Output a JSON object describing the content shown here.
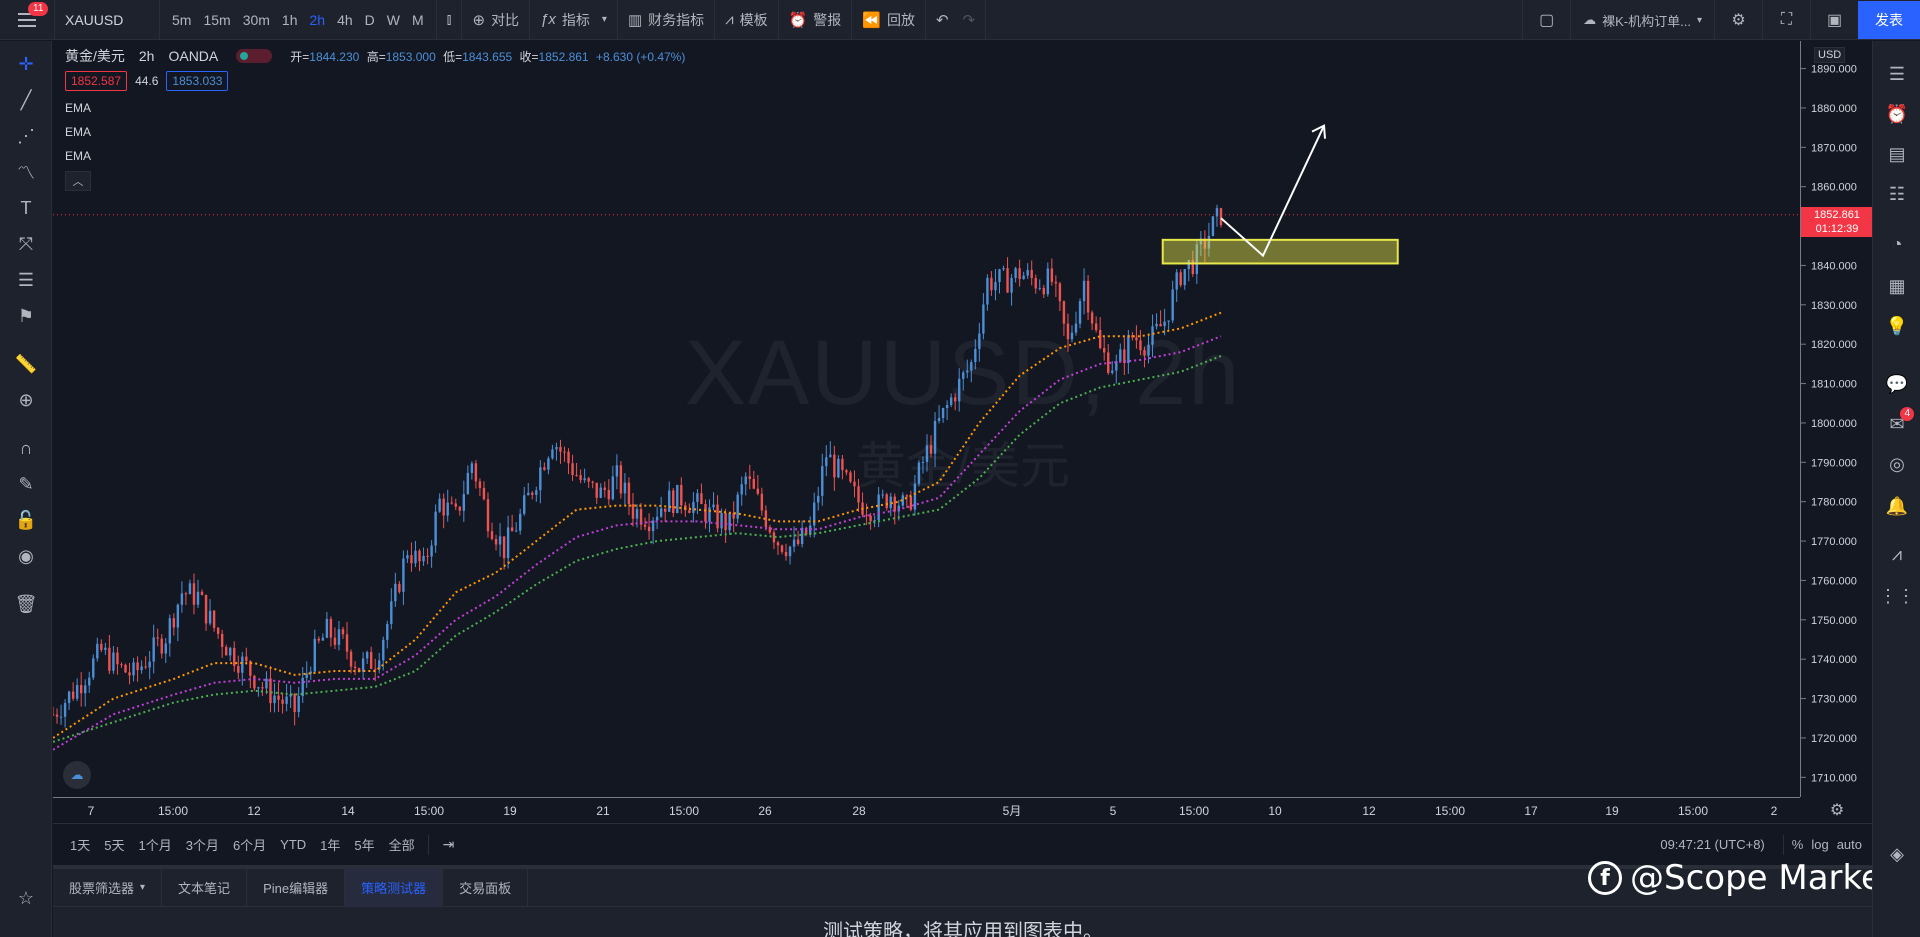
{
  "topbar": {
    "menu_badge": "11",
    "symbol": "XAUUSD",
    "intervals": [
      "5m",
      "15m",
      "30m",
      "1h",
      "2h",
      "4h",
      "D",
      "W",
      "M"
    ],
    "active_interval": "2h",
    "compare": "对比",
    "indicators": "指标",
    "financials": "财务指标",
    "templates": "模板",
    "alert": "警报",
    "replay": "回放",
    "layout_name": "裸K-机构订单...",
    "publish": "发表"
  },
  "legend": {
    "title": "黄金/美元",
    "interval": "2h",
    "exchange": "OANDA",
    "open_label": "开=",
    "open": "1844.230",
    "high_label": "高=",
    "high": "1853.000",
    "low_label": "低=",
    "low": "1843.655",
    "close_label": "收=",
    "close": "1852.861",
    "change": "+8.630 (+0.47%)",
    "bid": "1852.587",
    "spread": "44.6",
    "ask": "1853.033",
    "indicators": [
      "EMA",
      "EMA",
      "EMA"
    ]
  },
  "watermark": {
    "line1": "XAUUSD, 2h",
    "line2": "黄金/美元"
  },
  "price_axis": {
    "currency": "USD",
    "current_price": "1852.861",
    "countdown": "01:12:39"
  },
  "rangebar": {
    "ranges": [
      "1天",
      "5天",
      "1个月",
      "3个月",
      "6个月",
      "YTD",
      "1年",
      "5年",
      "全部"
    ],
    "time": "09:47:21 (UTC+8)",
    "percent": "%",
    "log": "log",
    "auto": "auto"
  },
  "bottom": {
    "tabs": [
      "股票筛选器",
      "文本笔记",
      "Pine编辑器",
      "策略测试器",
      "交易面板"
    ],
    "active_tab": "策略测试器",
    "message": "测试策略，将其应用到图表中。"
  },
  "brand": {
    "name": "@Scope Markets"
  },
  "colors": {
    "up": "#4c8fd6",
    "down": "#ef5350",
    "ema_fast": "#ff9800",
    "ema_mid": "#c040d8",
    "ema_slow": "#4caf50",
    "highlight": "#e8e84a",
    "accent": "#2962ff"
  },
  "chart_data": {
    "type": "candlestick",
    "symbol": "XAUUSD",
    "interval": "2h",
    "ylim": [
      1705,
      1897
    ],
    "y_ticks": [
      1710,
      1720,
      1730,
      1740,
      1750,
      1760,
      1770,
      1780,
      1790,
      1800,
      1810,
      1820,
      1830,
      1840,
      1850,
      1860,
      1870,
      1880,
      1890
    ],
    "x_ticks": [
      "7",
      "15:00",
      "12",
      "14",
      "15:00",
      "19",
      "21",
      "15:00",
      "26",
      "28",
      "5月",
      "5",
      "15:00",
      "10",
      "12",
      "15:00",
      "17",
      "19",
      "15:00",
      "2"
    ],
    "close_path": [
      [
        0,
        1726
      ],
      [
        12,
        1733
      ],
      [
        24,
        1742
      ],
      [
        32,
        1738
      ],
      [
        40,
        1736
      ],
      [
        48,
        1741
      ],
      [
        56,
        1746
      ],
      [
        64,
        1757
      ],
      [
        72,
        1756
      ],
      [
        80,
        1748
      ],
      [
        88,
        1742
      ],
      [
        96,
        1738
      ],
      [
        104,
        1733
      ],
      [
        112,
        1730
      ],
      [
        120,
        1727
      ],
      [
        128,
        1740
      ],
      [
        136,
        1747
      ],
      [
        144,
        1744
      ],
      [
        152,
        1738
      ],
      [
        160,
        1740
      ],
      [
        168,
        1752
      ],
      [
        176,
        1768
      ],
      [
        184,
        1763
      ],
      [
        192,
        1780
      ],
      [
        200,
        1776
      ],
      [
        208,
        1790
      ],
      [
        216,
        1776
      ],
      [
        224,
        1768
      ],
      [
        232,
        1776
      ],
      [
        240,
        1786
      ],
      [
        248,
        1796
      ],
      [
        256,
        1790
      ],
      [
        264,
        1784
      ],
      [
        272,
        1782
      ],
      [
        280,
        1786
      ],
      [
        288,
        1778
      ],
      [
        296,
        1776
      ],
      [
        304,
        1780
      ],
      [
        312,
        1781
      ],
      [
        320,
        1779
      ],
      [
        328,
        1776
      ],
      [
        336,
        1774
      ],
      [
        344,
        1786
      ],
      [
        352,
        1778
      ],
      [
        360,
        1770
      ],
      [
        368,
        1768
      ],
      [
        376,
        1773
      ],
      [
        384,
        1792
      ],
      [
        392,
        1786
      ],
      [
        400,
        1780
      ],
      [
        408,
        1778
      ],
      [
        416,
        1782
      ],
      [
        424,
        1778
      ],
      [
        432,
        1790
      ],
      [
        440,
        1800
      ],
      [
        448,
        1808
      ],
      [
        456,
        1815
      ],
      [
        464,
        1836
      ],
      [
        472,
        1836
      ],
      [
        480,
        1838
      ],
      [
        488,
        1836
      ],
      [
        496,
        1836
      ],
      [
        504,
        1820
      ],
      [
        512,
        1836
      ],
      [
        520,
        1818
      ],
      [
        528,
        1814
      ],
      [
        536,
        1822
      ],
      [
        544,
        1820
      ],
      [
        552,
        1826
      ],
      [
        560,
        1838
      ],
      [
        568,
        1842
      ],
      [
        576,
        1850
      ],
      [
        580,
        1853
      ]
    ],
    "ema_fast": [
      [
        0,
        1720
      ],
      [
        30,
        1730
      ],
      [
        60,
        1735
      ],
      [
        80,
        1739
      ],
      [
        100,
        1739
      ],
      [
        120,
        1736
      ],
      [
        140,
        1737
      ],
      [
        160,
        1737
      ],
      [
        180,
        1745
      ],
      [
        200,
        1757
      ],
      [
        220,
        1762
      ],
      [
        240,
        1770
      ],
      [
        260,
        1778
      ],
      [
        280,
        1779
      ],
      [
        300,
        1779
      ],
      [
        320,
        1778
      ],
      [
        340,
        1777
      ],
      [
        360,
        1775
      ],
      [
        380,
        1775
      ],
      [
        400,
        1778
      ],
      [
        420,
        1780
      ],
      [
        440,
        1785
      ],
      [
        460,
        1800
      ],
      [
        480,
        1812
      ],
      [
        500,
        1819
      ],
      [
        520,
        1822
      ],
      [
        540,
        1822
      ],
      [
        560,
        1824
      ],
      [
        580,
        1828
      ]
    ],
    "ema_mid": [
      [
        0,
        1717
      ],
      [
        30,
        1726
      ],
      [
        60,
        1731
      ],
      [
        80,
        1734
      ],
      [
        100,
        1735
      ],
      [
        120,
        1734
      ],
      [
        140,
        1735
      ],
      [
        160,
        1735
      ],
      [
        180,
        1741
      ],
      [
        200,
        1750
      ],
      [
        220,
        1756
      ],
      [
        240,
        1764
      ],
      [
        260,
        1771
      ],
      [
        280,
        1774
      ],
      [
        300,
        1775
      ],
      [
        320,
        1775
      ],
      [
        340,
        1774
      ],
      [
        360,
        1773
      ],
      [
        380,
        1773
      ],
      [
        400,
        1776
      ],
      [
        420,
        1778
      ],
      [
        440,
        1781
      ],
      [
        460,
        1792
      ],
      [
        480,
        1803
      ],
      [
        500,
        1811
      ],
      [
        520,
        1815
      ],
      [
        540,
        1816
      ],
      [
        560,
        1818
      ],
      [
        580,
        1822
      ]
    ],
    "ema_slow": [
      [
        0,
        1719
      ],
      [
        30,
        1724
      ],
      [
        60,
        1729
      ],
      [
        80,
        1731
      ],
      [
        100,
        1732
      ],
      [
        120,
        1731
      ],
      [
        140,
        1732
      ],
      [
        160,
        1733
      ],
      [
        180,
        1737
      ],
      [
        200,
        1746
      ],
      [
        220,
        1752
      ],
      [
        240,
        1759
      ],
      [
        260,
        1765
      ],
      [
        280,
        1768
      ],
      [
        300,
        1770
      ],
      [
        320,
        1771
      ],
      [
        340,
        1772
      ],
      [
        360,
        1771
      ],
      [
        380,
        1772
      ],
      [
        400,
        1774
      ],
      [
        420,
        1776
      ],
      [
        440,
        1778
      ],
      [
        460,
        1786
      ],
      [
        480,
        1797
      ],
      [
        500,
        1805
      ],
      [
        520,
        1809
      ],
      [
        540,
        1811
      ],
      [
        560,
        1813
      ],
      [
        580,
        1817
      ]
    ],
    "current_price": 1852.861,
    "zone": {
      "low": 1840.5,
      "high": 1846.5
    }
  }
}
